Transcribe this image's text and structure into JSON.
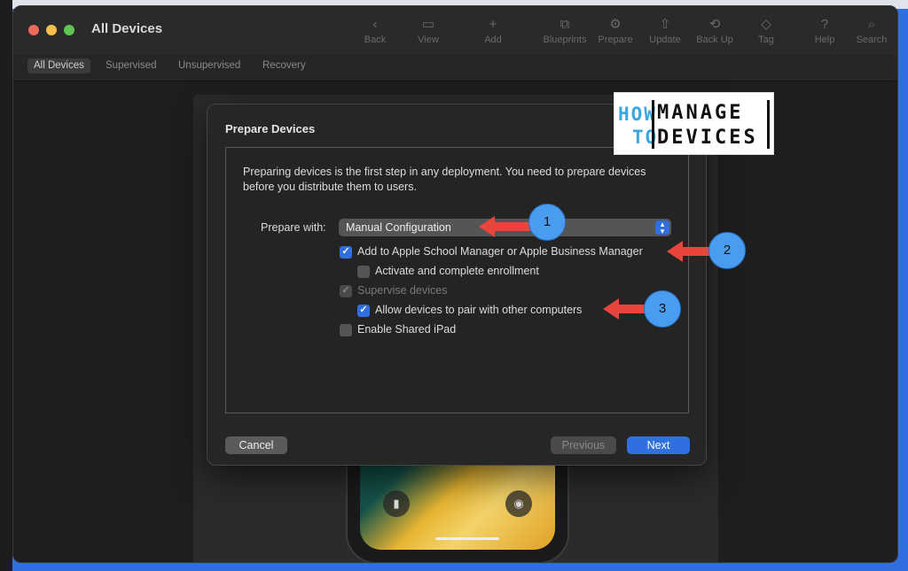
{
  "window": {
    "title": "All Devices"
  },
  "toolbar": [
    {
      "label": "Back",
      "icon": "‹"
    },
    {
      "label": "View",
      "icon": "▭"
    },
    {
      "label": "Add",
      "icon": "+"
    },
    {
      "label": "Blueprints",
      "icon": "⧉"
    },
    {
      "label": "Prepare",
      "icon": "⚙"
    },
    {
      "label": "Update",
      "icon": "⇧"
    },
    {
      "label": "Back Up",
      "icon": "⟲"
    },
    {
      "label": "Tag",
      "icon": "◇"
    },
    {
      "label": "Help",
      "icon": "?"
    },
    {
      "label": "Search",
      "icon": "⌕"
    }
  ],
  "tabs": [
    "All Devices",
    "Supervised",
    "Unsupervised",
    "Recovery"
  ],
  "dialog": {
    "title": "Prepare Devices",
    "intro": "Preparing devices is the first step in any deployment. You need to prepare devices before you distribute them to users.",
    "prepare_label": "Prepare with:",
    "prepare_value": "Manual Configuration",
    "options": {
      "add_to_asm": "Add to Apple School Manager or Apple Business Manager",
      "activate": "Activate and complete enrollment",
      "supervise": "Supervise devices",
      "allow_pair": "Allow devices to pair with other computers",
      "shared_ipad": "Enable Shared iPad"
    },
    "buttons": {
      "cancel": "Cancel",
      "previous": "Previous",
      "next": "Next"
    }
  },
  "annotations": [
    "1",
    "2",
    "3"
  ],
  "logo": {
    "how": "HOW",
    "to": "TO",
    "manage": "MANAGE",
    "devices": "DEVICES"
  },
  "colors": {
    "accent": "#2f6fe0",
    "arrow": "#e8453c",
    "badge": "#4a9cf0"
  }
}
